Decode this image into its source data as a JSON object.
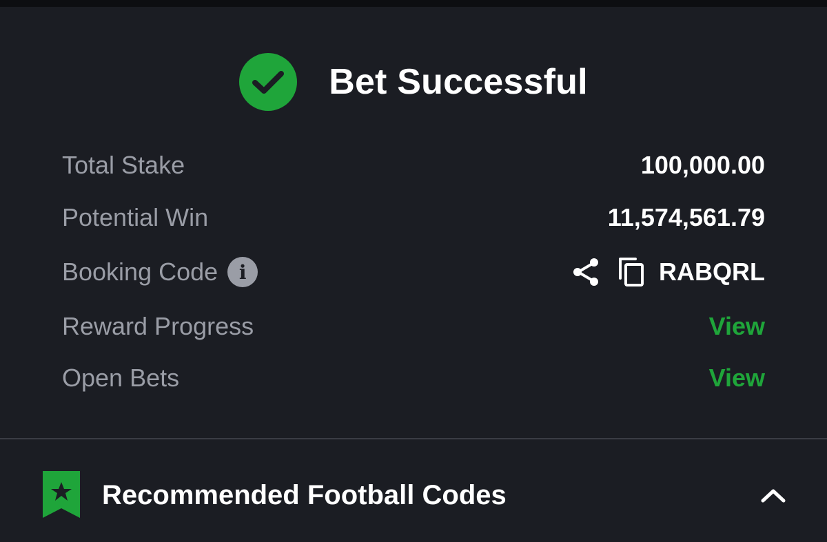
{
  "header": {
    "title": "Bet Successful",
    "status_icon": "check-circle-icon",
    "status_color": "#1fa53a"
  },
  "details": {
    "total_stake": {
      "label": "Total Stake",
      "value": "100,000.00"
    },
    "potential_win": {
      "label": "Potential Win",
      "value": "11,574,561.79"
    },
    "booking_code": {
      "label": "Booking Code",
      "info_icon": "info-icon",
      "share_icon": "share-icon",
      "copy_icon": "copy-icon",
      "value": "RABQRL"
    },
    "reward_progress": {
      "label": "Reward Progress",
      "link": "View"
    },
    "open_bets": {
      "label": "Open Bets",
      "link": "View"
    }
  },
  "recommended": {
    "title": "Recommended Football Codes",
    "icon": "bookmark-star-icon",
    "toggle_icon": "chevron-up-icon"
  },
  "colors": {
    "background": "#1b1d23",
    "accent": "#1fa53a",
    "label": "#9a9da6",
    "text": "#ffffff"
  }
}
